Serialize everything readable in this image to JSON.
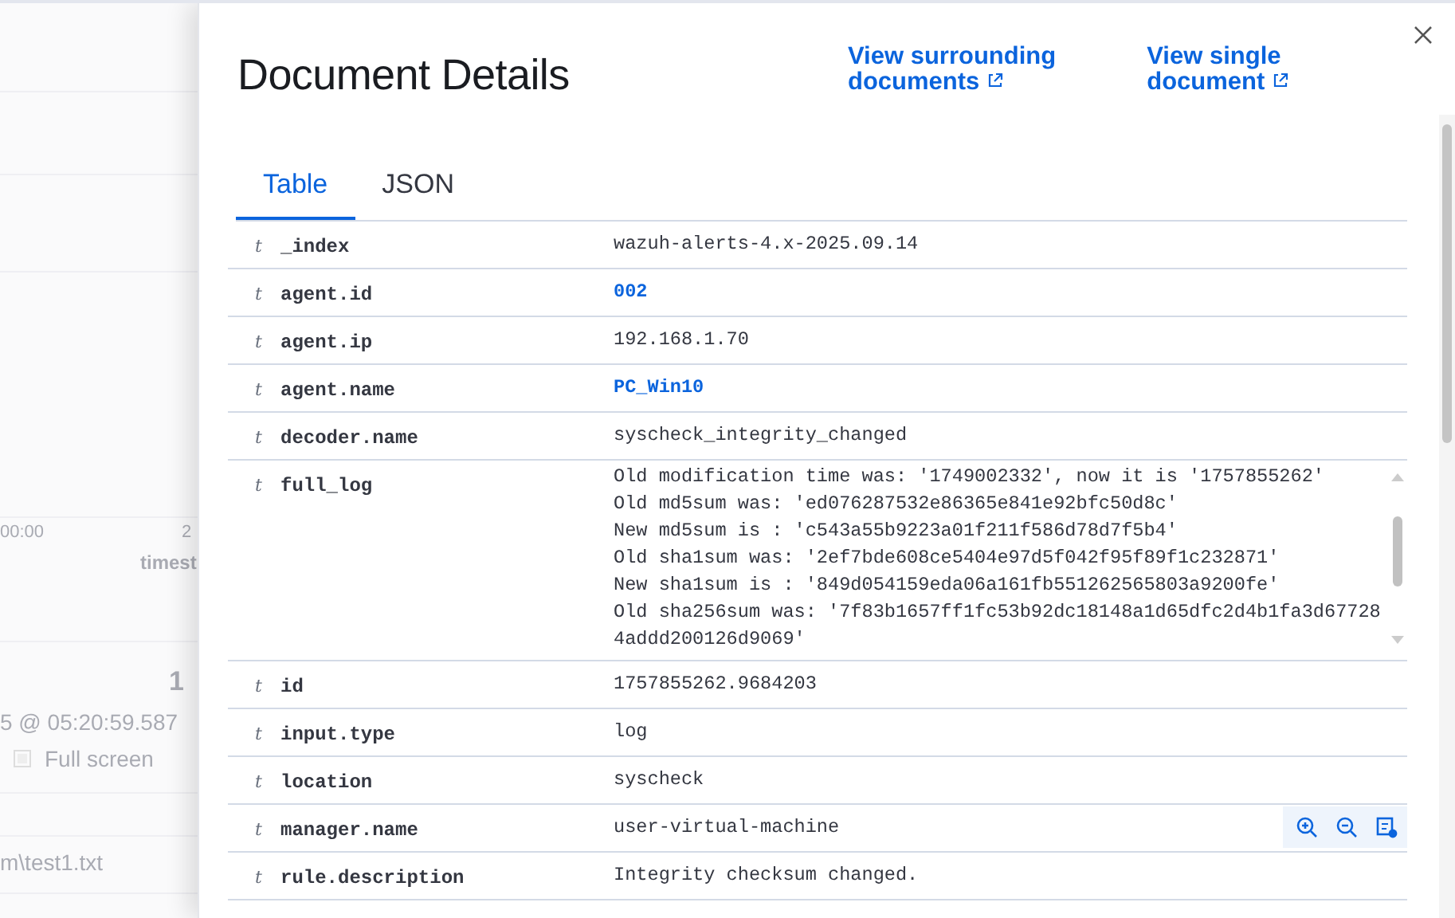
{
  "background": {
    "axis_tick": "00:00",
    "axis_tick_2": "2",
    "axis_label": "timest",
    "hits": "1",
    "time_range": "5 @ 05:20:59.587",
    "full_screen": "Full screen",
    "row_text": "m\\test1.txt"
  },
  "flyout": {
    "title": "Document Details",
    "links": [
      {
        "label_1": "View surrounding",
        "label_2": "documents"
      },
      {
        "label_1": "View single",
        "label_2": "document"
      }
    ],
    "tabs": [
      {
        "label": "Table",
        "selected": true
      },
      {
        "label": "JSON",
        "selected": false
      }
    ],
    "rows": [
      {
        "type": "t",
        "field": "_index",
        "kind": "text",
        "value": "wazuh-alerts-4.x-2025.09.14",
        "hovered": false
      },
      {
        "type": "t",
        "field": "agent.id",
        "kind": "link",
        "value": "002",
        "hovered": false
      },
      {
        "type": "t",
        "field": "agent.ip",
        "kind": "text",
        "value": "192.168.1.70",
        "hovered": false
      },
      {
        "type": "t",
        "field": "agent.name",
        "kind": "link",
        "value": "PC_Win10",
        "hovered": false
      },
      {
        "type": "t",
        "field": "decoder.name",
        "kind": "text",
        "value": "syscheck_integrity_changed",
        "hovered": false
      },
      {
        "type": "t",
        "field": "full_log",
        "kind": "log",
        "value": "Old modification time was: '1749002332', now it is '1757855262'\nOld md5sum was: 'ed076287532e86365e841e92bfc50d8c'\nNew md5sum is : 'c543a55b9223a01f211f586d78d7f5b4'\nOld sha1sum was: '2ef7bde608ce5404e97d5f042f95f89f1c232871'\nNew sha1sum is : '849d054159eda06a161fb551262565803a9200fe'\nOld sha256sum was: '7f83b1657ff1fc53b92dc18148a1d65dfc2d4b1fa3d677284addd200126d9069'",
        "hovered": false
      },
      {
        "type": "t",
        "field": "id",
        "kind": "text",
        "value": "1757855262.9684203",
        "hovered": false
      },
      {
        "type": "t",
        "field": "input.type",
        "kind": "text",
        "value": "log",
        "hovered": false
      },
      {
        "type": "t",
        "field": "location",
        "kind": "text",
        "value": "syscheck",
        "hovered": false
      },
      {
        "type": "t",
        "field": "manager.name",
        "kind": "text",
        "value": "user-virtual-machine",
        "hovered": true
      },
      {
        "type": "t",
        "field": "rule.description",
        "kind": "text",
        "value": "Integrity checksum changed.",
        "hovered": false
      }
    ]
  }
}
